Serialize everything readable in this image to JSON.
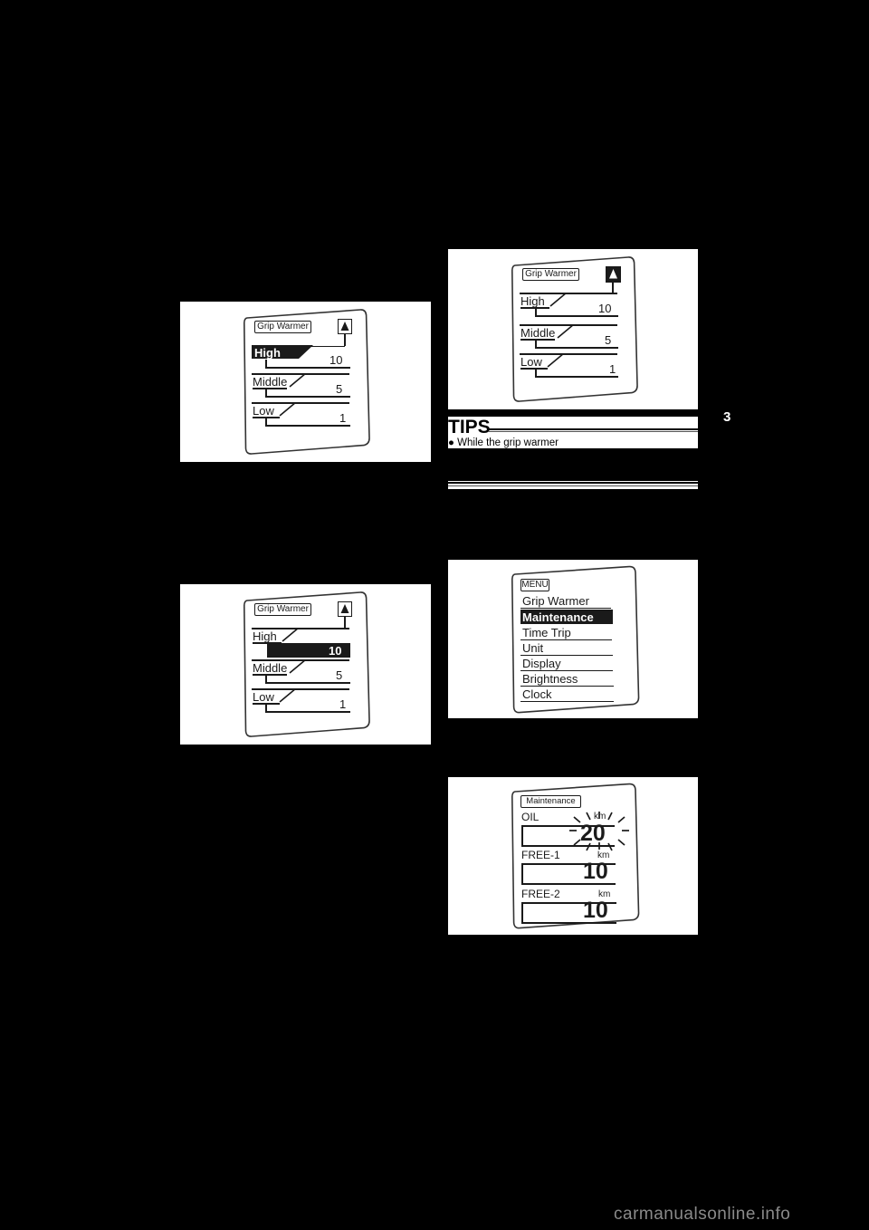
{
  "page": {
    "number": "3",
    "background_color": "#000000",
    "watermark": "carmanualsonline.info"
  },
  "figures": [
    {
      "id": "grip-warmer-high-selected",
      "title_chip": "Grip Warmer",
      "arrow_icon": "up-arrow-icon",
      "arrow_style": "outline",
      "rows": [
        {
          "label": "High",
          "value": "10",
          "highlight": "label"
        },
        {
          "label": "Middle",
          "value": "5",
          "highlight": "none"
        },
        {
          "label": "Low",
          "value": "1",
          "highlight": "none"
        }
      ]
    },
    {
      "id": "grip-warmer-high-value-selected",
      "title_chip": "Grip Warmer",
      "arrow_icon": "up-arrow-icon",
      "arrow_style": "outline",
      "rows": [
        {
          "label": "High",
          "value": "10",
          "highlight": "value"
        },
        {
          "label": "Middle",
          "value": "5",
          "highlight": "none"
        },
        {
          "label": "Low",
          "value": "1",
          "highlight": "none"
        }
      ]
    },
    {
      "id": "grip-warmer-confirmed",
      "title_chip": "Grip Warmer",
      "arrow_icon": "up-arrow-icon",
      "arrow_style": "filled",
      "rows": [
        {
          "label": "High",
          "value": "10",
          "highlight": "none"
        },
        {
          "label": "Middle",
          "value": "5",
          "highlight": "none"
        },
        {
          "label": "Low",
          "value": "1",
          "highlight": "none"
        }
      ]
    },
    {
      "id": "main-menu",
      "title_chip": "MENU",
      "items": [
        {
          "label": "Grip Warmer",
          "selected": false
        },
        {
          "label": "Maintenance",
          "selected": true
        },
        {
          "label": "Time Trip",
          "selected": false
        },
        {
          "label": "Unit",
          "selected": false
        },
        {
          "label": "Display",
          "selected": false
        },
        {
          "label": "Brightness",
          "selected": false
        },
        {
          "label": "Clock",
          "selected": false
        }
      ]
    },
    {
      "id": "maintenance",
      "title_chip": "Maintenance",
      "rows": [
        {
          "label": "OIL",
          "value": "20",
          "unit": "km",
          "flashing": true
        },
        {
          "label": "FREE-1",
          "value": "10",
          "unit": "km",
          "flashing": false
        },
        {
          "label": "FREE-2",
          "value": "10",
          "unit": "km",
          "flashing": false
        }
      ]
    }
  ],
  "tips": {
    "heading": "TIPS",
    "body": "● While the grip warmer"
  }
}
